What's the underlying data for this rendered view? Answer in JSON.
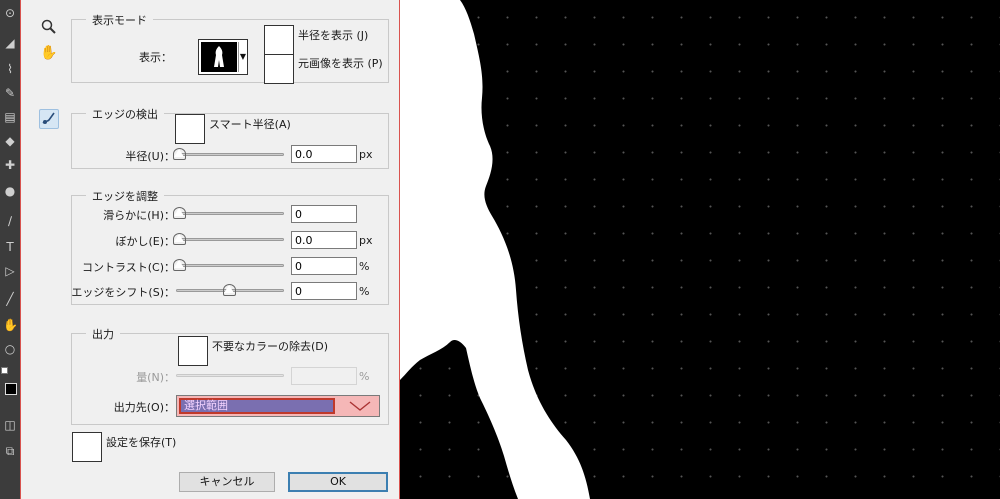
{
  "canvas": {
    "bg_color": "#000000",
    "subject_color": "#ffffff"
  },
  "view_mode": {
    "legend": "表示モード",
    "view_label": "表示：",
    "show_radius": "半径を表示 (J)",
    "show_original": "元画像を表示 (P)"
  },
  "edge_detection": {
    "legend": "エッジの検出",
    "smart_radius": "スマート半径(A)",
    "radius_label": "半径(U)：",
    "radius_value": "0.0",
    "radius_unit": "px"
  },
  "adjust_edge": {
    "legend": "エッジを調整",
    "rows": [
      {
        "label": "滑らかに(H)：",
        "value": "0",
        "unit": "",
        "level": 0
      },
      {
        "label": "ぼかし(E)：",
        "value": "0.0",
        "unit": "px",
        "level": 0
      },
      {
        "label": "コントラスト(C)：",
        "value": "0",
        "unit": "%",
        "level": 0
      },
      {
        "label": "エッジをシフト(S)：",
        "value": "0",
        "unit": "%",
        "level": 0.5
      }
    ]
  },
  "output": {
    "legend": "出力",
    "decontaminate": "不要なカラーの除去(D)",
    "amount_label": "量(N)：",
    "amount_unit": "%",
    "output_to_label": "出力先(O)：",
    "output_to_value": "選択範囲"
  },
  "remember": "設定を保存(T)",
  "buttons": {
    "cancel": "キャンセル",
    "ok": "OK"
  },
  "tools": {
    "zoom": "zoom-icon",
    "hand": "hand-icon",
    "refine_radius": "refine-radius-brush-icon"
  }
}
